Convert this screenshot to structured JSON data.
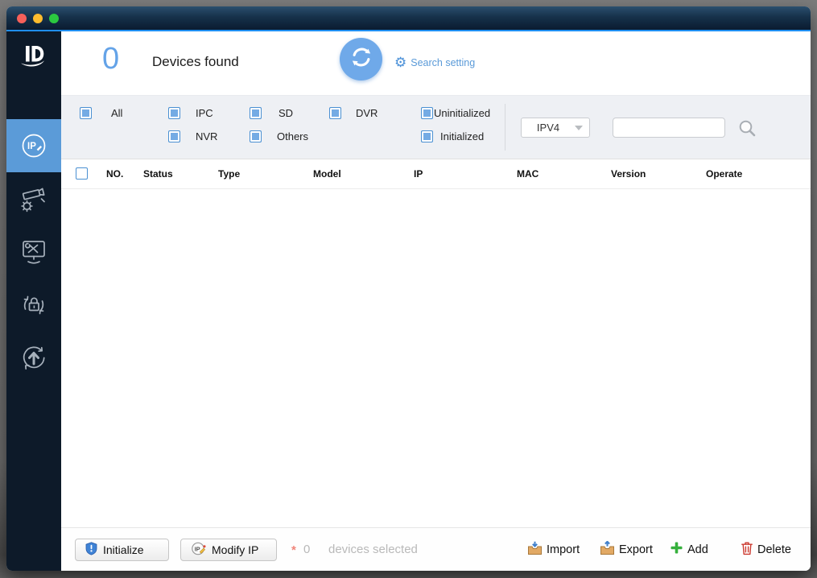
{
  "window": {
    "controls": [
      {
        "name": "close",
        "color": "#f6605a"
      },
      {
        "name": "minimize",
        "color": "#fdbc2e"
      },
      {
        "name": "maximize",
        "color": "#2bc840"
      }
    ]
  },
  "sidebar": {
    "items": [
      {
        "icon": "modify-ip-icon",
        "selected": true
      },
      {
        "icon": "device-config-icon",
        "selected": false
      },
      {
        "icon": "system-settings-icon",
        "selected": false
      },
      {
        "icon": "password-reset-icon",
        "selected": false
      },
      {
        "icon": "device-upgrade-icon",
        "selected": false
      }
    ]
  },
  "header": {
    "device_count": "0",
    "device_count_label": "Devices found",
    "search_setting_label": "Search setting"
  },
  "filters": {
    "types": [
      {
        "label": "All",
        "checked": true
      },
      {
        "label": "IPC",
        "checked": true
      },
      {
        "label": "NVR",
        "checked": true
      },
      {
        "label": "SD",
        "checked": true
      },
      {
        "label": "Others",
        "checked": true
      },
      {
        "label": "DVR",
        "checked": true
      }
    ],
    "states": [
      {
        "label": "Uninitialized",
        "checked": true
      },
      {
        "label": "Initialized",
        "checked": true
      }
    ],
    "ip_version": "IPV4",
    "search_value": ""
  },
  "table": {
    "select_all_checked": false,
    "columns": [
      "NO.",
      "Status",
      "Type",
      "Model",
      "IP",
      "MAC",
      "Version",
      "Operate"
    ],
    "rows": []
  },
  "footer": {
    "initialize_label": "Initialize",
    "modify_ip_label": "Modify IP",
    "required_marker": "*",
    "selected_count": "0",
    "selected_label": "devices selected",
    "import_label": "Import",
    "export_label": "Export",
    "add_label": "Add",
    "delete_label": "Delete"
  },
  "colors": {
    "accent_blue": "#5b9bd8",
    "count_blue": "#64a3e8",
    "sidebar_bg": "#0d1a29",
    "titlebar_bottom": "#0a1b30",
    "topline_blue": "#1f8ff2",
    "filter_bar_bg": "#eef0f4",
    "checkbox_border": "#4a90d2",
    "checkbox_fill": "#74abe4",
    "muted_text": "#b9b9b9",
    "required_red": "#f0857a"
  }
}
